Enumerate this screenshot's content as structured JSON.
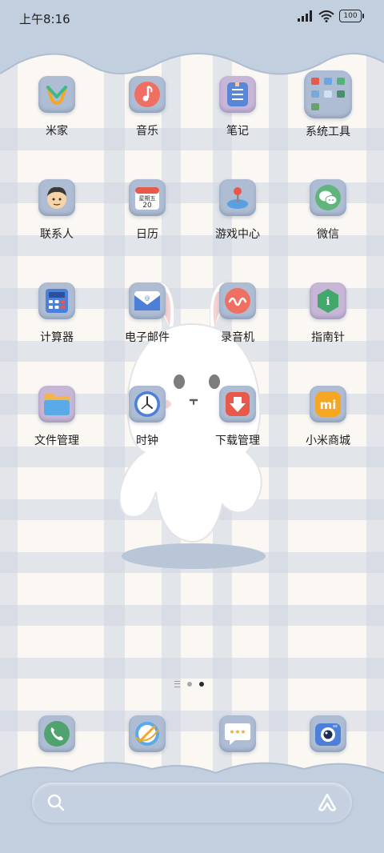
{
  "status_bar": {
    "time": "上午8:16",
    "battery": "100"
  },
  "apps": [
    {
      "label": "米家",
      "icon": "mijia-icon"
    },
    {
      "label": "音乐",
      "icon": "music-icon"
    },
    {
      "label": "笔记",
      "icon": "notes-icon"
    },
    {
      "label": "系统工具",
      "icon": "system-tools-folder-icon"
    },
    {
      "label": "联系人",
      "icon": "contacts-icon"
    },
    {
      "label": "日历",
      "icon": "calendar-icon"
    },
    {
      "label": "游戏中心",
      "icon": "game-center-icon"
    },
    {
      "label": "微信",
      "icon": "wechat-icon"
    },
    {
      "label": "计算器",
      "icon": "calculator-icon"
    },
    {
      "label": "电子邮件",
      "icon": "email-icon"
    },
    {
      "label": "录音机",
      "icon": "recorder-icon"
    },
    {
      "label": "指南针",
      "icon": "compass-icon"
    },
    {
      "label": "文件管理",
      "icon": "file-manager-icon"
    },
    {
      "label": "时钟",
      "icon": "clock-icon"
    },
    {
      "label": "下载管理",
      "icon": "downloads-icon"
    },
    {
      "label": "小米商城",
      "icon": "mi-store-icon"
    }
  ],
  "calendar_icon": {
    "weekday": "星期五",
    "day": "20"
  },
  "mi_store_icon": {
    "text": "mi"
  },
  "dock": [
    {
      "name": "phone",
      "icon": "phone-icon"
    },
    {
      "name": "browser",
      "icon": "browser-icon"
    },
    {
      "name": "messages",
      "icon": "messages-icon"
    },
    {
      "name": "camera",
      "icon": "camera-icon"
    }
  ],
  "page_indicator": {
    "pages": 2,
    "active_page": 2
  },
  "colors": {
    "plaid_stripe": "#d9dfe8",
    "cloud": "#c2cfdf",
    "icon_frame": "#aebdd3",
    "search_bar": "#c5d1e0"
  }
}
